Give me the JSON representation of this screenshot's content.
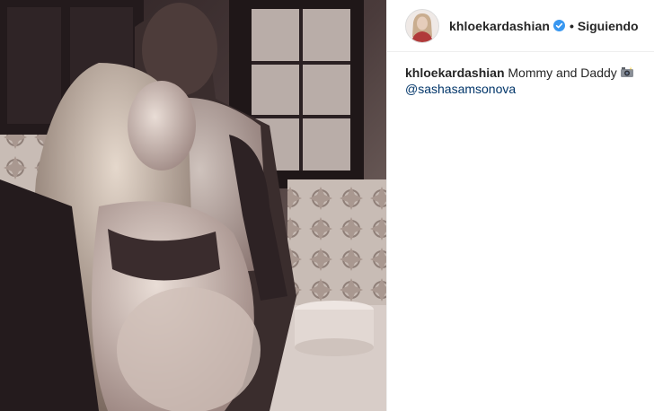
{
  "header": {
    "username": "khloekardashian",
    "separator": "•",
    "follow_label": "Siguiendo"
  },
  "caption": {
    "username": "khloekardashian",
    "text": "Mommy and Daddy",
    "emoji": "camera-with-flash-icon",
    "mention": "@sashasamsonova"
  },
  "photo": {
    "description_icon": "photo",
    "tone": "#6b5a55"
  },
  "colors": {
    "text": "#262626",
    "mention": "#003569",
    "verified": "#3897f0",
    "border": "#efefef"
  }
}
